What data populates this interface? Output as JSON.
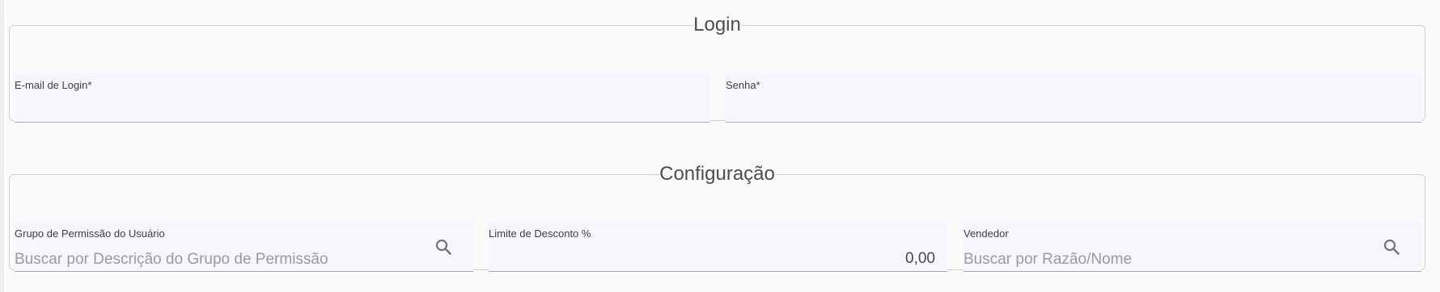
{
  "login": {
    "title": "Login",
    "email_label": "E-mail de Login*",
    "password_label": "Senha*"
  },
  "config": {
    "title": "Configuração",
    "group_label": "Grupo de Permissão do Usuário",
    "group_placeholder": "Buscar por Descrição do Grupo de Permissão",
    "discount_label": "Limite de Desconto %",
    "discount_value": "0,00",
    "seller_label": "Vendedor",
    "seller_placeholder": "Buscar por Razão/Nome"
  },
  "icons": {
    "group_search": "search-icon",
    "seller_search": "search-icon"
  },
  "colors": {
    "field_bg": "#f5f6ff",
    "page_bg": "#fafafa",
    "border": "#cfcfcf"
  }
}
